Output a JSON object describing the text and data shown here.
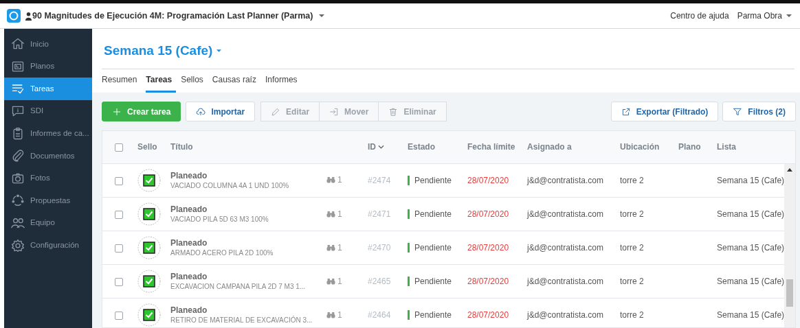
{
  "topbar": {
    "title": "90 Magnitudes de Ejecución 4M: Programación Last Planner (Parma)",
    "help": "Centro de ajuda",
    "user": "Parma Obra"
  },
  "sidebar": {
    "items": [
      {
        "label": "Inicio",
        "selected": false
      },
      {
        "label": "Planos",
        "selected": false
      },
      {
        "label": "Tareas",
        "selected": true
      },
      {
        "label": "SDI",
        "selected": false
      },
      {
        "label": "Informes de ca...",
        "selected": false
      },
      {
        "label": "Documentos",
        "selected": false
      },
      {
        "label": "Fotos",
        "selected": false
      },
      {
        "label": "Propuestas",
        "selected": false
      },
      {
        "label": "Equipo",
        "selected": false
      },
      {
        "label": "Configuración",
        "selected": false
      }
    ]
  },
  "page_title": "Semana 15 (Cafe)",
  "tabs": [
    {
      "label": "Resumen",
      "selected": false
    },
    {
      "label": "Tareas",
      "selected": true
    },
    {
      "label": "Sellos",
      "selected": false
    },
    {
      "label": "Causas raíz",
      "selected": false
    },
    {
      "label": "Informes",
      "selected": false
    }
  ],
  "toolbar": {
    "left": [
      {
        "label": "Crear tarea",
        "kind": "primary",
        "disabled": false
      },
      {
        "label": "Importar",
        "kind": "outline",
        "disabled": false
      },
      {
        "label": "Editar",
        "kind": "grouped",
        "disabled": true
      },
      {
        "label": "Mover",
        "kind": "grouped",
        "disabled": true
      },
      {
        "label": "Eliminar",
        "kind": "grouped",
        "disabled": true
      }
    ],
    "right": [
      {
        "label": "Exportar (Filtrado)"
      },
      {
        "label": "Filtros (2)"
      }
    ]
  },
  "table": {
    "select_all_checked": false,
    "columns": [
      {
        "label": "Sello",
        "sorted": false
      },
      {
        "label": "Título",
        "sorted": false
      },
      {
        "label": "ID",
        "sorted": true
      },
      {
        "label": "Estado",
        "sorted": false
      },
      {
        "label": "Fecha límite",
        "sorted": false
      },
      {
        "label": "Asignado a",
        "sorted": false
      },
      {
        "label": "Ubicación",
        "sorted": false
      },
      {
        "label": "Plano",
        "sorted": false
      },
      {
        "label": "Lista",
        "sorted": false
      }
    ],
    "rows": [
      {
        "checked": false,
        "stamp": "Planeado",
        "title": "VACIADO COLUMNA 4A 1 UND 100%",
        "views": "1",
        "id": "#2474",
        "status": "Pendiente",
        "due": "28/07/2020",
        "overdue": true,
        "assignee": "j&d@contratista.com",
        "location": "torre 2",
        "list": "Semana 15 (Cafe)"
      },
      {
        "checked": false,
        "stamp": "Planeado",
        "title": "VACIADO PILA 5D 63 M3 100%",
        "views": "1",
        "id": "#2471",
        "status": "Pendiente",
        "due": "28/07/2020",
        "overdue": true,
        "assignee": "j&d@contratista.com",
        "location": "torre 2",
        "list": "Semana 15 (Cafe)"
      },
      {
        "checked": false,
        "stamp": "Planeado",
        "title": "ARMADO ACERO PILA 2D 100%",
        "views": "1",
        "id": "#2470",
        "status": "Pendiente",
        "due": "28/07/2020",
        "overdue": true,
        "assignee": "j&d@contratista.com",
        "location": "torre 2",
        "list": "Semana 15 (Cafe)"
      },
      {
        "checked": false,
        "stamp": "Planeado",
        "title": "EXCAVACION CAMPANA PILA 2D 7 M3 1...",
        "views": "1",
        "id": "#2465",
        "status": "Pendiente",
        "due": "28/07/2020",
        "overdue": true,
        "assignee": "j&d@contratista.com",
        "location": "torre 2",
        "list": "Semana 15 (Cafe)"
      },
      {
        "checked": false,
        "stamp": "Planeado",
        "title": "RETIRO DE MATERIAL DE EXCAVACIÓN 3...",
        "views": "1",
        "id": "#2464",
        "status": "Pendiente",
        "due": "28/07/2020",
        "overdue": true,
        "assignee": "j&d@contratista.com",
        "location": "torre 2",
        "list": "Semana 15 (Cafe)"
      }
    ]
  }
}
